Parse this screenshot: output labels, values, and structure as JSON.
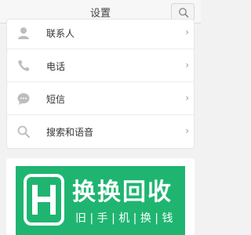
{
  "header": {
    "title": "设置",
    "search_icon": "search-icon"
  },
  "settings": {
    "items": [
      {
        "label": "联系人",
        "icon": "contact-icon"
      },
      {
        "label": "电话",
        "icon": "phone-icon"
      },
      {
        "label": "短信",
        "icon": "message-icon"
      },
      {
        "label": "搜索和语音",
        "icon": "search-icon"
      }
    ],
    "chevron": "›"
  },
  "banner": {
    "title": "换换回收",
    "subtitle": "旧 | 手 | 机 | 换 | 钱",
    "background_color": "#1fb571"
  },
  "colors": {
    "icon_gray": "#bdbdbd",
    "text": "#333333"
  }
}
